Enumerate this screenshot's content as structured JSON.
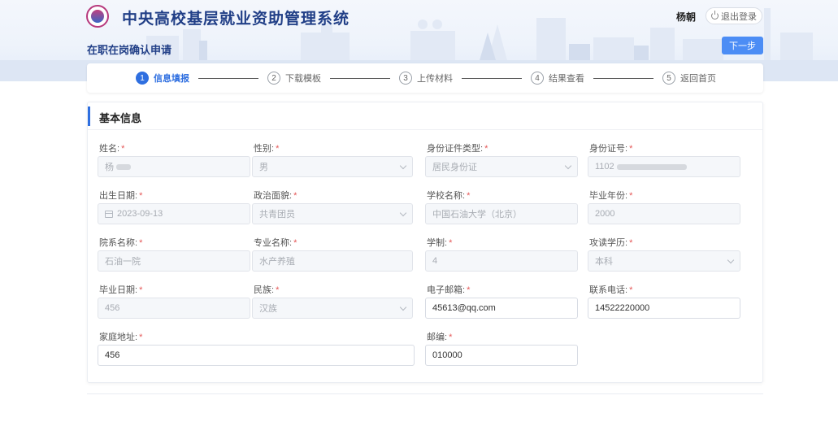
{
  "header": {
    "system_title": "中央高校基层就业资助管理系统",
    "user_name": "杨朝",
    "logout_label": "退出登录",
    "page_title": "在职在岗确认申请",
    "next_label": "下一步"
  },
  "steps": [
    {
      "num": "1",
      "label": "信息填报",
      "active": true
    },
    {
      "num": "2",
      "label": "下载模板",
      "active": false
    },
    {
      "num": "3",
      "label": "上传材料",
      "active": false
    },
    {
      "num": "4",
      "label": "结果查看",
      "active": false
    },
    {
      "num": "5",
      "label": "返回首页",
      "active": false
    }
  ],
  "card": {
    "title": "基本信息",
    "required_mark": "*",
    "fields": {
      "name": {
        "label": "姓名:",
        "value": "杨"
      },
      "gender": {
        "label": "性别:",
        "value": "男"
      },
      "id_type": {
        "label": "身份证件类型:",
        "value": "居民身份证"
      },
      "id_number": {
        "label": "身份证号:",
        "value": "1102"
      },
      "birth_date": {
        "label": "出生日期:",
        "value": "2023-09-13"
      },
      "political_status": {
        "label": "政治面貌:",
        "value": "共青团员"
      },
      "school_name": {
        "label": "学校名称:",
        "value": "中国石油大学（北京）"
      },
      "graduation_year": {
        "label": "毕业年份:",
        "value": "2000"
      },
      "department": {
        "label": "院系名称:",
        "value": "石油一院"
      },
      "major": {
        "label": "专业名称:",
        "value": "水产养殖"
      },
      "duration": {
        "label": "学制:",
        "value": "4"
      },
      "degree": {
        "label": "攻读学历:",
        "value": "本科"
      },
      "graduation_date": {
        "label": "毕业日期:",
        "value": "456"
      },
      "ethnicity": {
        "label": "民族:",
        "value": "汉族"
      },
      "email": {
        "label": "电子邮箱:",
        "value": "45613@qq.com"
      },
      "phone": {
        "label": "联系电话:",
        "value": "14522220000"
      },
      "address": {
        "label": "家庭地址:",
        "value": "456"
      },
      "postcode": {
        "label": "邮编:",
        "value": "010000"
      }
    }
  },
  "colors": {
    "primary": "#2f6fe0",
    "brand_title": "#213f87",
    "required": "#e45757"
  }
}
